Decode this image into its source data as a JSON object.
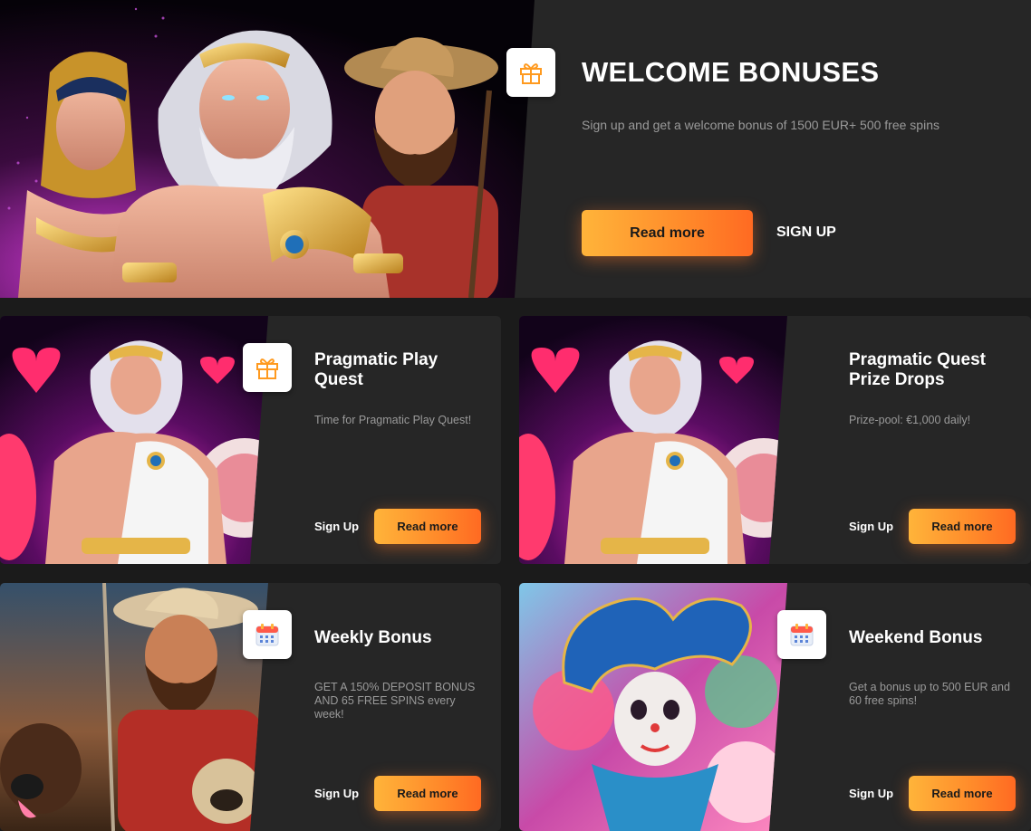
{
  "hero": {
    "title": "WELCOME BONUSES",
    "description": "Sign up and get a welcome bonus of 1500 EUR+ 500 free spins",
    "read_more": "Read more",
    "sign_up": "SIGN UP",
    "icon": "gift-icon"
  },
  "cards": [
    {
      "title": "Pragmatic Play Quest",
      "description": "Time for Pragmatic Play Quest!",
      "sign_up": "Sign Up",
      "read_more": "Read more",
      "icon": "gift-icon"
    },
    {
      "title": "Pragmatic Quest Prize Drops",
      "description": "Prize-pool: €1,000 daily!",
      "sign_up": "Sign Up",
      "read_more": "Read more",
      "icon": "gift-icon"
    },
    {
      "title": "Weekly Bonus",
      "description": "GET A 150% DEPOSIT BONUS AND 65 FREE SPINS every week!",
      "sign_up": "Sign Up",
      "read_more": "Read more",
      "icon": "calendar-icon"
    },
    {
      "title": "Weekend Bonus",
      "description": "Get a bonus up to 500 EUR and 60 free spins!",
      "sign_up": "Sign Up",
      "read_more": "Read more",
      "icon": "calendar-icon"
    }
  ],
  "colors": {
    "accent_orange": "#ff8a2a",
    "background": "#1b1b1b",
    "card_background": "#262626",
    "muted_text": "#9a9a9a"
  }
}
